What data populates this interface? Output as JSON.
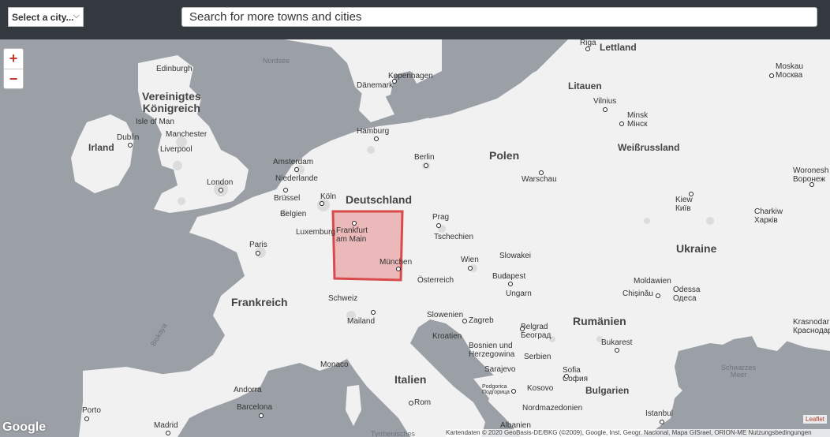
{
  "header": {
    "city_select": "Select a city...",
    "search_placeholder": "Search for more towns and cities"
  },
  "map": {
    "zoom_in": "+",
    "zoom_out": "−",
    "countries": {
      "uk": [
        "Vereinigtes",
        "Königreich"
      ],
      "ireland": "Irland",
      "germany": "Deutschland",
      "poland": "Polen",
      "belarus": "Weißrussland",
      "lithuania": "Litauen",
      "latvia": "Lettland",
      "ukraine": "Ukraine",
      "france": "Frankreich",
      "italy": "Italien",
      "romania": "Rumänien",
      "bulgaria": "Bulgarien",
      "czech": "Tschechien",
      "slovakia": "Slowakei",
      "austria": "Österreich",
      "hungary": "Ungarn",
      "switzerland": "Schweiz",
      "slovenia": "Slowenien",
      "croatia": "Kroatien",
      "bosnia": [
        "Bosnien und",
        "Herzegowina"
      ],
      "serbia": "Serbien",
      "kosovo": "Kosovo",
      "north_macedonia": "Nordmazedonien",
      "albania": "Albanien",
      "moldova": "Moldawien",
      "denmark": "Dänemark",
      "netherlands": "Niederlande",
      "belgium": "Belgien",
      "luxembourg": "Luxemburg",
      "andorra": "Andorra",
      "monaco": "Monaco",
      "isle_of_man": "Isle of Man"
    },
    "cities": {
      "edinburgh": "Edinburgh",
      "dublin": "Dublin",
      "manchester": "Manchester",
      "liverpool": "Liverpool",
      "london": "London",
      "amsterdam": "Amsterdam",
      "brussels": "Brüssel",
      "paris": "Paris",
      "cologne": "Köln",
      "hamburg": "Hamburg",
      "berlin": "Berlin",
      "copenhagen": "Kopenhagen",
      "frankfurt": [
        "Frankfurt",
        "am Main"
      ],
      "munich": "München",
      "prague": "Prag",
      "vienna": "Wien",
      "budapest": "Budapest",
      "warsaw": "Warschau",
      "vilnius": "Vilnius",
      "minsk": "Minsk",
      "minsk_local": "Мінск",
      "riga": "Riga",
      "moscow": "Moskau",
      "moscow_local": "Москва",
      "kyiv": "Kiew",
      "kyiv_local": "Київ",
      "kharkiv": "Charkiw",
      "kharkiv_local": "Харків",
      "voronezh": "Woronesh",
      "voronezh_local": "Воронеж",
      "chisinau": "Chișinău",
      "odesa": "Odessa",
      "odesa_local": "Одеса",
      "krasnodar": "Krasnodar",
      "krasnodar_local": "Краснодар",
      "bucharest": "Bukarest",
      "sofia": "Sofia",
      "sofia_local": "София",
      "belgrade": "Belgrad",
      "belgrade_local": "Београд",
      "sarajevo": "Sarajevo",
      "podgorica": "Podgorica",
      "podgorica_local": "Подгорица",
      "zagreb": "Zagreb",
      "milan": "Mailand",
      "rome": "Rom",
      "barcelona": "Barcelona",
      "porto": "Porto",
      "madrid": "Madrid",
      "istanbul": "Istanbul"
    },
    "seas": {
      "north_sea": "Nordsee",
      "biscay": "Biskaya",
      "black_sea": [
        "Schwarzes",
        "Meer"
      ],
      "tyrrhenian": "Tyrrhenisches"
    },
    "selection_color": "#e05050",
    "attribution": "Kartendaten © 2020 GeoBasis-DE/BKG (©2009), Google, Inst. Geogr. Nacional, Mapa GISrael, ORION-ME    Nutzungsbedingungen",
    "leaflet": "Leaflet",
    "google": "Google"
  }
}
